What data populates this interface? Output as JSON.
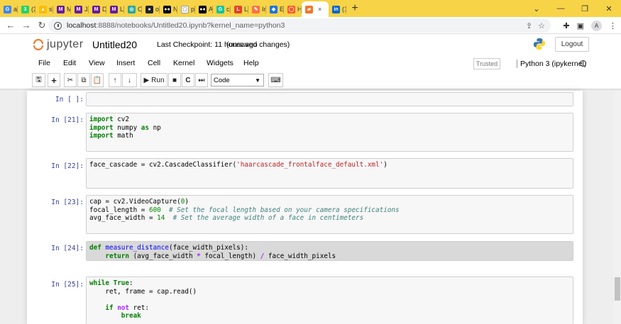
{
  "browser": {
    "tabs": [
      {
        "label": "aw",
        "icon": "g-logo-icon",
        "color": "#4285f4",
        "glyph": "G"
      },
      {
        "label": "(3",
        "icon": "whatsapp-icon",
        "color": "#25d366",
        "glyph": "3"
      },
      {
        "label": "sa",
        "icon": "drive-icon",
        "color": "#fbbc04",
        "glyph": "▲"
      },
      {
        "label": "Mi",
        "icon": "m-icon",
        "color": "#6a1b9a",
        "glyph": "M"
      },
      {
        "label": "JA",
        "icon": "m-icon",
        "color": "#6a1b9a",
        "glyph": "M"
      },
      {
        "label": "Dc",
        "icon": "m-icon",
        "color": "#6a1b9a",
        "glyph": "M"
      },
      {
        "label": "LII",
        "icon": "m-icon",
        "color": "#6a1b9a",
        "glyph": "M"
      },
      {
        "label": "Ch",
        "icon": "globe-icon",
        "color": "#26a69a",
        "glyph": "◎"
      },
      {
        "label": "op",
        "icon": "github-icon",
        "color": "#222222",
        "glyph": "●"
      },
      {
        "label": "Nc",
        "icon": "medium-icon",
        "color": "#000000",
        "glyph": "●●"
      },
      {
        "label": "py",
        "icon": "page-icon",
        "color": "#ffffff",
        "glyph": "▢"
      },
      {
        "label": "Ac",
        "icon": "medium-icon",
        "color": "#000000",
        "glyph": "●●"
      },
      {
        "label": "ca",
        "icon": "grammarly-icon",
        "color": "#15c39a",
        "glyph": "G"
      },
      {
        "label": "La",
        "icon": "gitlab-icon",
        "color": "#e24329",
        "glyph": "L"
      },
      {
        "label": "In",
        "icon": "edit-icon",
        "color": "#ff7043",
        "glyph": "✎"
      },
      {
        "label": "Ex",
        "icon": "extension-icon",
        "color": "#1a73e8",
        "glyph": "◆"
      },
      {
        "label": "Hc",
        "icon": "hc-icon",
        "color": "#ff5722",
        "glyph": "◯"
      },
      {
        "label": "",
        "icon": "active-tab-icon",
        "color": "#f37626",
        "glyph": "▰"
      },
      {
        "label": "(1",
        "icon": "linkedin-icon",
        "color": "#0a66c2",
        "glyph": "in"
      }
    ],
    "active_tab_close": "×",
    "new_tab": "+",
    "url_host": "localhost",
    "url_path": ":8888/notebooks/Untitled20.ipynb?kernel_name=python3",
    "profile_initial": "A"
  },
  "jupyter": {
    "logo_text": "jupyter",
    "notebook_title": "Untitled20",
    "checkpoint": "Last Checkpoint: 11 hours ago",
    "save_status": "(unsaved changes)",
    "logout": "Logout",
    "menus": [
      "File",
      "Edit",
      "View",
      "Insert",
      "Cell",
      "Kernel",
      "Widgets",
      "Help"
    ],
    "trusted": "Trusted",
    "kernel": "Python 3 (ipykernel)",
    "run_label": "Run",
    "cell_type": "Code"
  },
  "cells": [
    {
      "prompt": "In [ ]:"
    },
    {
      "prompt": "In [21]:"
    },
    {
      "prompt": "In [22]:"
    },
    {
      "prompt": "In [23]:"
    },
    {
      "prompt": "In [24]:"
    },
    {
      "prompt": "In [25]:"
    }
  ],
  "code": {
    "c21_l1": [
      "import",
      " cv2"
    ],
    "c21_l2": [
      "import",
      " numpy ",
      "as",
      " np"
    ],
    "c21_l3": [
      "import",
      " math"
    ],
    "c22_l1": [
      "face_cascade = cv2.CascadeClassifier(",
      "'haarcascade_frontalface_default.xml'",
      ")"
    ],
    "c23_l1": [
      "cap = cv2.VideoCapture(",
      "0",
      ")"
    ],
    "c23_l2": [
      "focal_length = ",
      "600",
      "  ",
      "# Set the focal length based on your camera specifications"
    ],
    "c23_l3": [
      "avg_face_width = ",
      "14",
      "  ",
      "# Set the average width of a face in centimeters"
    ],
    "c24_l1": [
      "def",
      " ",
      "measure_distance",
      "(face_width_pixels):"
    ],
    "c24_l2": [
      "    ",
      "return",
      " (avg_face_width ",
      "*",
      " focal_length) ",
      "/",
      " face_width_pixels"
    ],
    "c25_l1": [
      "while",
      " ",
      "True",
      ":"
    ],
    "c25_l2": [
      "    ret, frame = cap.read()"
    ],
    "c25_l4": [
      "    ",
      "if",
      " ",
      "not",
      " ret:"
    ],
    "c25_l5": [
      "        ",
      "break"
    ]
  }
}
